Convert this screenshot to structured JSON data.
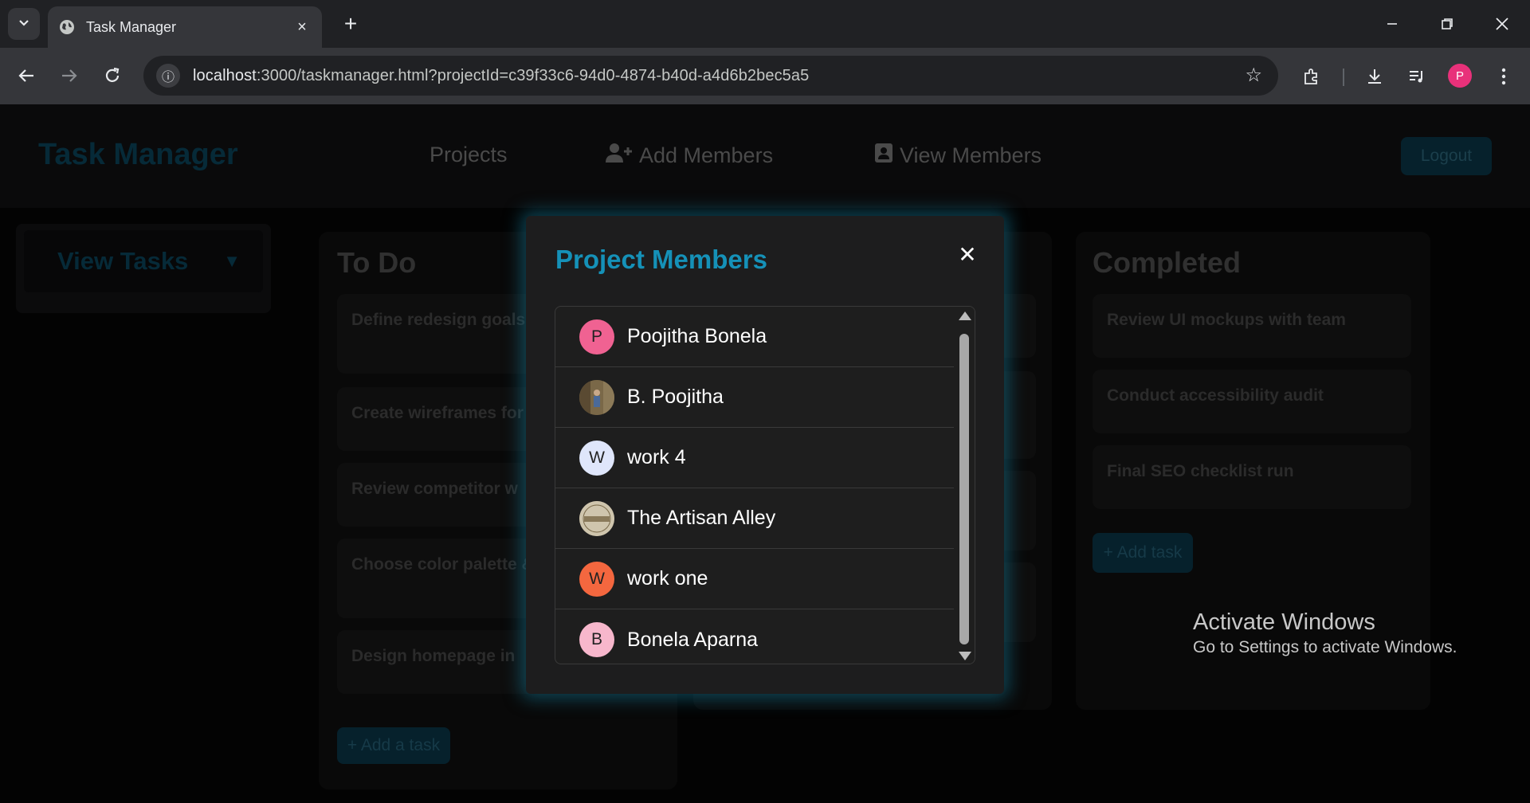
{
  "browser": {
    "tab_title": "Task Manager",
    "url_host": "localhost",
    "url_rest": ":3000/taskmanager.html?projectId=c39f33c6-94d0-4874-b40d-a4d6b2bec5a5",
    "profile_initial": "P",
    "profile_color": "#e8317a"
  },
  "app": {
    "brand": "Task Manager",
    "nav": {
      "projects": "Projects",
      "add_members": "Add Members",
      "view_members": "View Members"
    },
    "logout": "Logout",
    "sidebar_label": "View Tasks"
  },
  "columns": {
    "todo": {
      "title": "To Do",
      "cards": [
        "Define redesign goals & audience",
        "Create wireframes for",
        "Review competitor w",
        "Choose color palette & typography",
        "Design homepage in"
      ],
      "add_label": "+ Add a task"
    },
    "completed": {
      "title": "Completed",
      "cards": [
        "Review UI mockups with team",
        "Conduct accessibility audit",
        "Final SEO checklist run"
      ],
      "add_label": "+ Add task"
    }
  },
  "modal": {
    "title": "Project Members",
    "close_symbol": "✕",
    "members": [
      {
        "name": "Poojitha Bonela",
        "initial": "P",
        "color": "#f06292"
      },
      {
        "name": "B. Poojitha",
        "initial": "",
        "color": "#6d5a3a"
      },
      {
        "name": "work 4",
        "initial": "W",
        "color": "#dfe6fb"
      },
      {
        "name": "The Artisan Alley",
        "initial": "",
        "color": "#cfc5ad"
      },
      {
        "name": "work one",
        "initial": "W",
        "color": "#f4673f"
      },
      {
        "name": "Bonela Aparna",
        "initial": "B",
        "color": "#f7b7cc"
      }
    ]
  },
  "watermark": {
    "line1": "Activate Windows",
    "line2": "Go to Settings to activate Windows."
  }
}
